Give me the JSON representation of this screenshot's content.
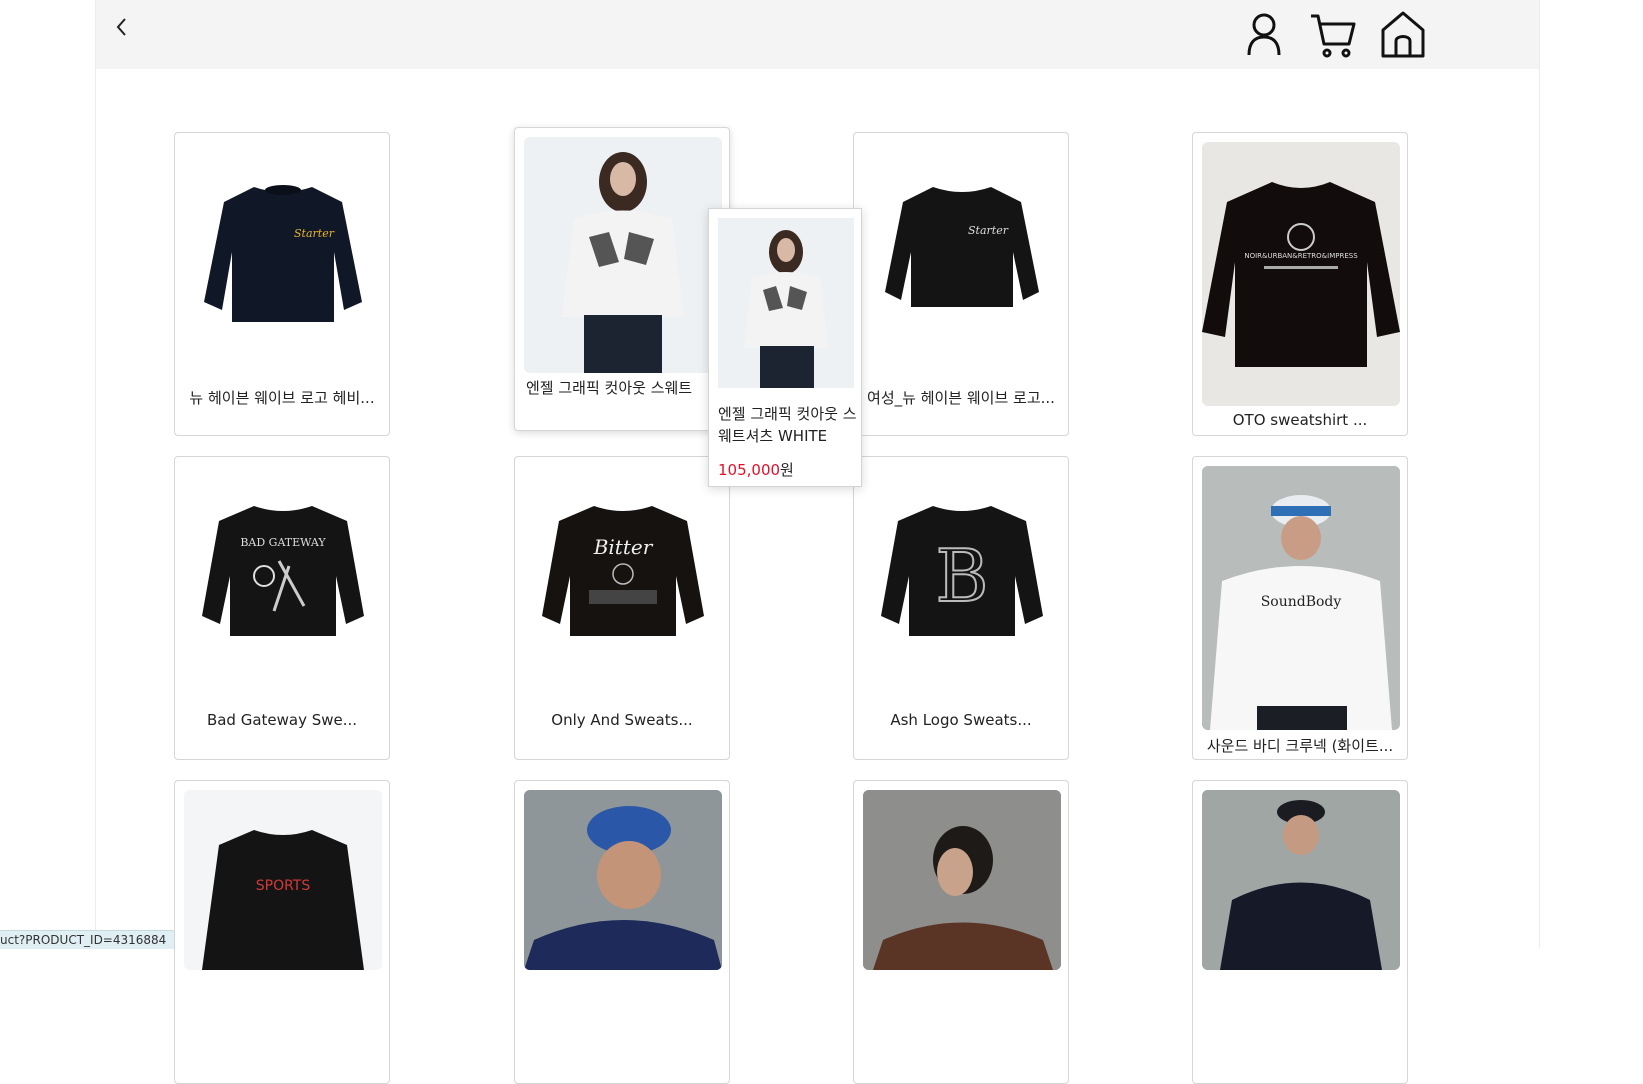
{
  "header": {
    "back": "back-arrow",
    "icons": [
      "user-icon",
      "cart-icon",
      "home-icon"
    ]
  },
  "products": [
    {
      "name": "뉴 헤이븐 웨이브 로고 헤비...",
      "style": "navy-logo"
    },
    {
      "name": "엔젤 그래픽 컷아웃 스웨트",
      "style": "model-white"
    },
    {
      "name": "여성_뉴 헤이븐 웨이브 로고...",
      "style": "black-crop"
    },
    {
      "name": "OTO sweatshirt ...",
      "style": "black-print"
    },
    {
      "name": "Bad Gateway Swe...",
      "style": "black-graphic"
    },
    {
      "name": "Only And Sweats...",
      "style": "black-bitter"
    },
    {
      "name": "Ash Logo Sweats...",
      "style": "black-b"
    },
    {
      "name": "사운드 바디 크루넥 (화이트...",
      "style": "model-white-cap"
    },
    {
      "name": "",
      "style": "black-sports"
    },
    {
      "name": "",
      "style": "model-navy"
    },
    {
      "name": "",
      "style": "model-brown"
    },
    {
      "name": "",
      "style": "model-black"
    }
  ],
  "hover_popup": {
    "name": "엔젤 그래픽 컷아웃 스웨트셔츠 WHITE",
    "price": "105,000",
    "currency": "원"
  },
  "status_bar": {
    "url": "uct?PRODUCT_ID=4316884"
  },
  "colors": {
    "topbar": "#f4f4f4",
    "price": "#e2102a",
    "card_border": "#d6d6d6"
  }
}
